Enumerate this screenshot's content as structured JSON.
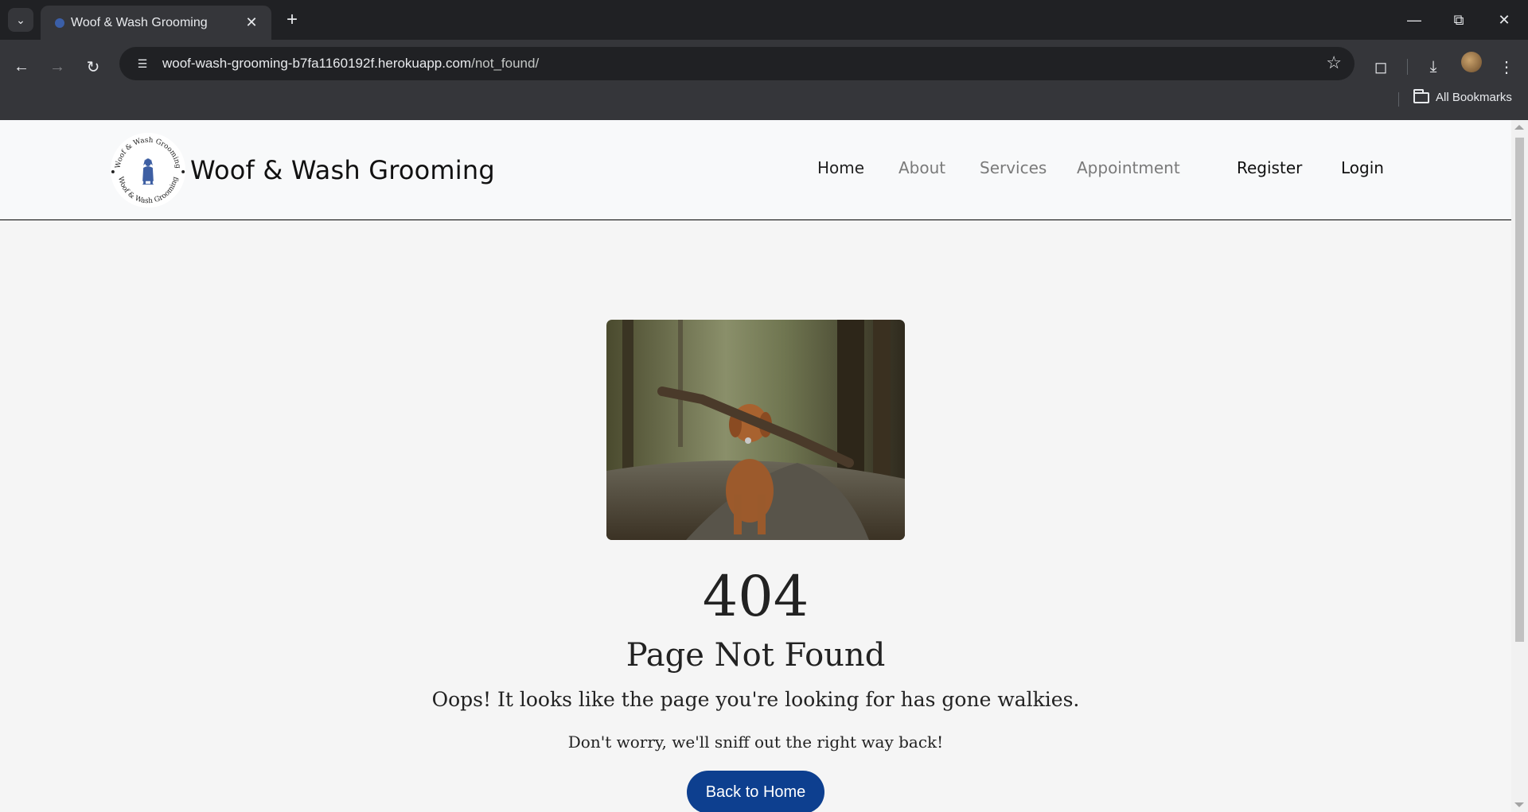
{
  "browser": {
    "tab_title": "Woof & Wash Grooming",
    "url_host": "woof-wash-grooming-b7fa1160192f.herokuapp.com",
    "url_path": "/not_found/",
    "bookmarks_label": "All Bookmarks"
  },
  "site": {
    "brand_name": "Woof & Wash Grooming",
    "logo_text": "Woof & Wash Grooming",
    "nav": {
      "home": "Home",
      "about": "About",
      "services": "Services",
      "appointment": "Appointment",
      "register": "Register",
      "login": "Login"
    }
  },
  "error": {
    "code": "404",
    "title": "Page Not Found",
    "message": "Oops! It looks like the page you're looking for has gone walkies.",
    "submessage": "Don't worry, we'll sniff out the right way back!",
    "button": "Back to Home"
  },
  "colors": {
    "primary_button": "#0d3f8f",
    "page_background": "#f5f5f5",
    "nav_background": "#f8f9fa"
  }
}
